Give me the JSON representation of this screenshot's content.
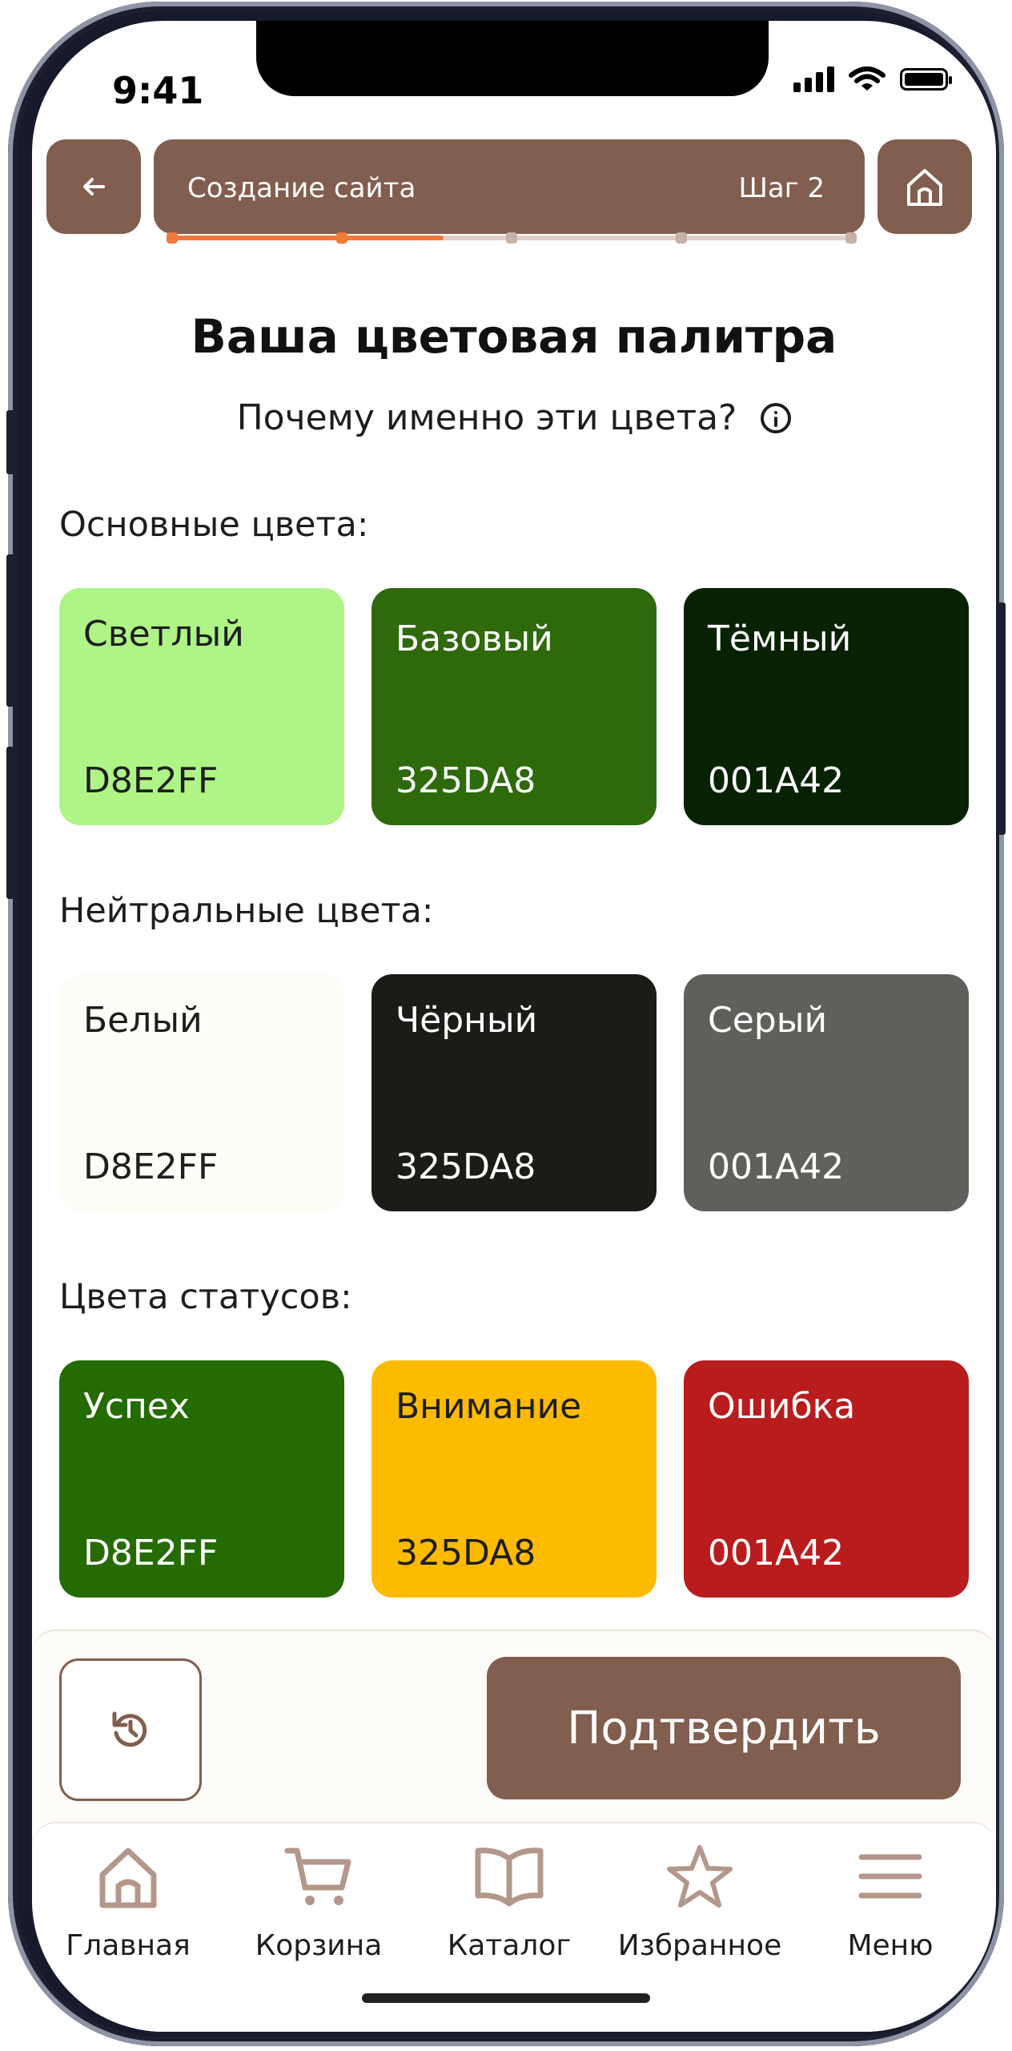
{
  "status_bar": {
    "time": "9:41"
  },
  "header": {
    "title": "Создание сайта",
    "step": "Шаг 2",
    "progress_fraction": 0.4
  },
  "page": {
    "title": "Ваша цветовая палитра",
    "subtitle": "Почему именно эти цвета?"
  },
  "sections": [
    {
      "title": "Основные цвета:",
      "swatches": [
        {
          "name": "Светлый",
          "code": "D8E2FF",
          "color": "#aef486",
          "text_color": "#1e1e1e"
        },
        {
          "name": "Базовый",
          "code": "325DA8",
          "color": "#2e6a0c",
          "text_color": "#ffffff"
        },
        {
          "name": "Тёмный",
          "code": "001A42",
          "color": "#072200",
          "text_color": "#ffffff"
        }
      ]
    },
    {
      "title": "Нейтральные цвета:",
      "swatches": [
        {
          "name": "Белый",
          "code": "D8E2FF",
          "color": "#fdfcf5",
          "text_color": "#1e1e1e"
        },
        {
          "name": "Чёрный",
          "code": "325DA8",
          "color": "#1b1c18",
          "text_color": "#ffffff"
        },
        {
          "name": "Серый",
          "code": "001A42",
          "color": "#5f605b",
          "text_color": "#ffffff"
        }
      ]
    },
    {
      "title": "Цвета статусов:",
      "swatches": [
        {
          "name": "Успех",
          "code": "D8E2FF",
          "color": "#246b02",
          "text_color": "#ffffff"
        },
        {
          "name": "Внимание",
          "code": "325DA8",
          "color": "#fdbb00",
          "text_color": "#1e1e1e"
        },
        {
          "name": "Ошибка",
          "code": "001A42",
          "color": "#b91c1c",
          "text_color": "#ffffff"
        }
      ]
    }
  ],
  "actions": {
    "confirm_label": "Подтвердить"
  },
  "tabbar": {
    "items": [
      {
        "label": "Главная",
        "icon": "home-icon"
      },
      {
        "label": "Корзина",
        "icon": "cart-icon"
      },
      {
        "label": "Каталог",
        "icon": "book-icon"
      },
      {
        "label": "Избранное",
        "icon": "star-icon"
      },
      {
        "label": "Меню",
        "icon": "menu-icon"
      }
    ]
  },
  "colors": {
    "brand": "#825e4f",
    "accent": "#f07a3a",
    "tab_icon": "#b4978b"
  }
}
